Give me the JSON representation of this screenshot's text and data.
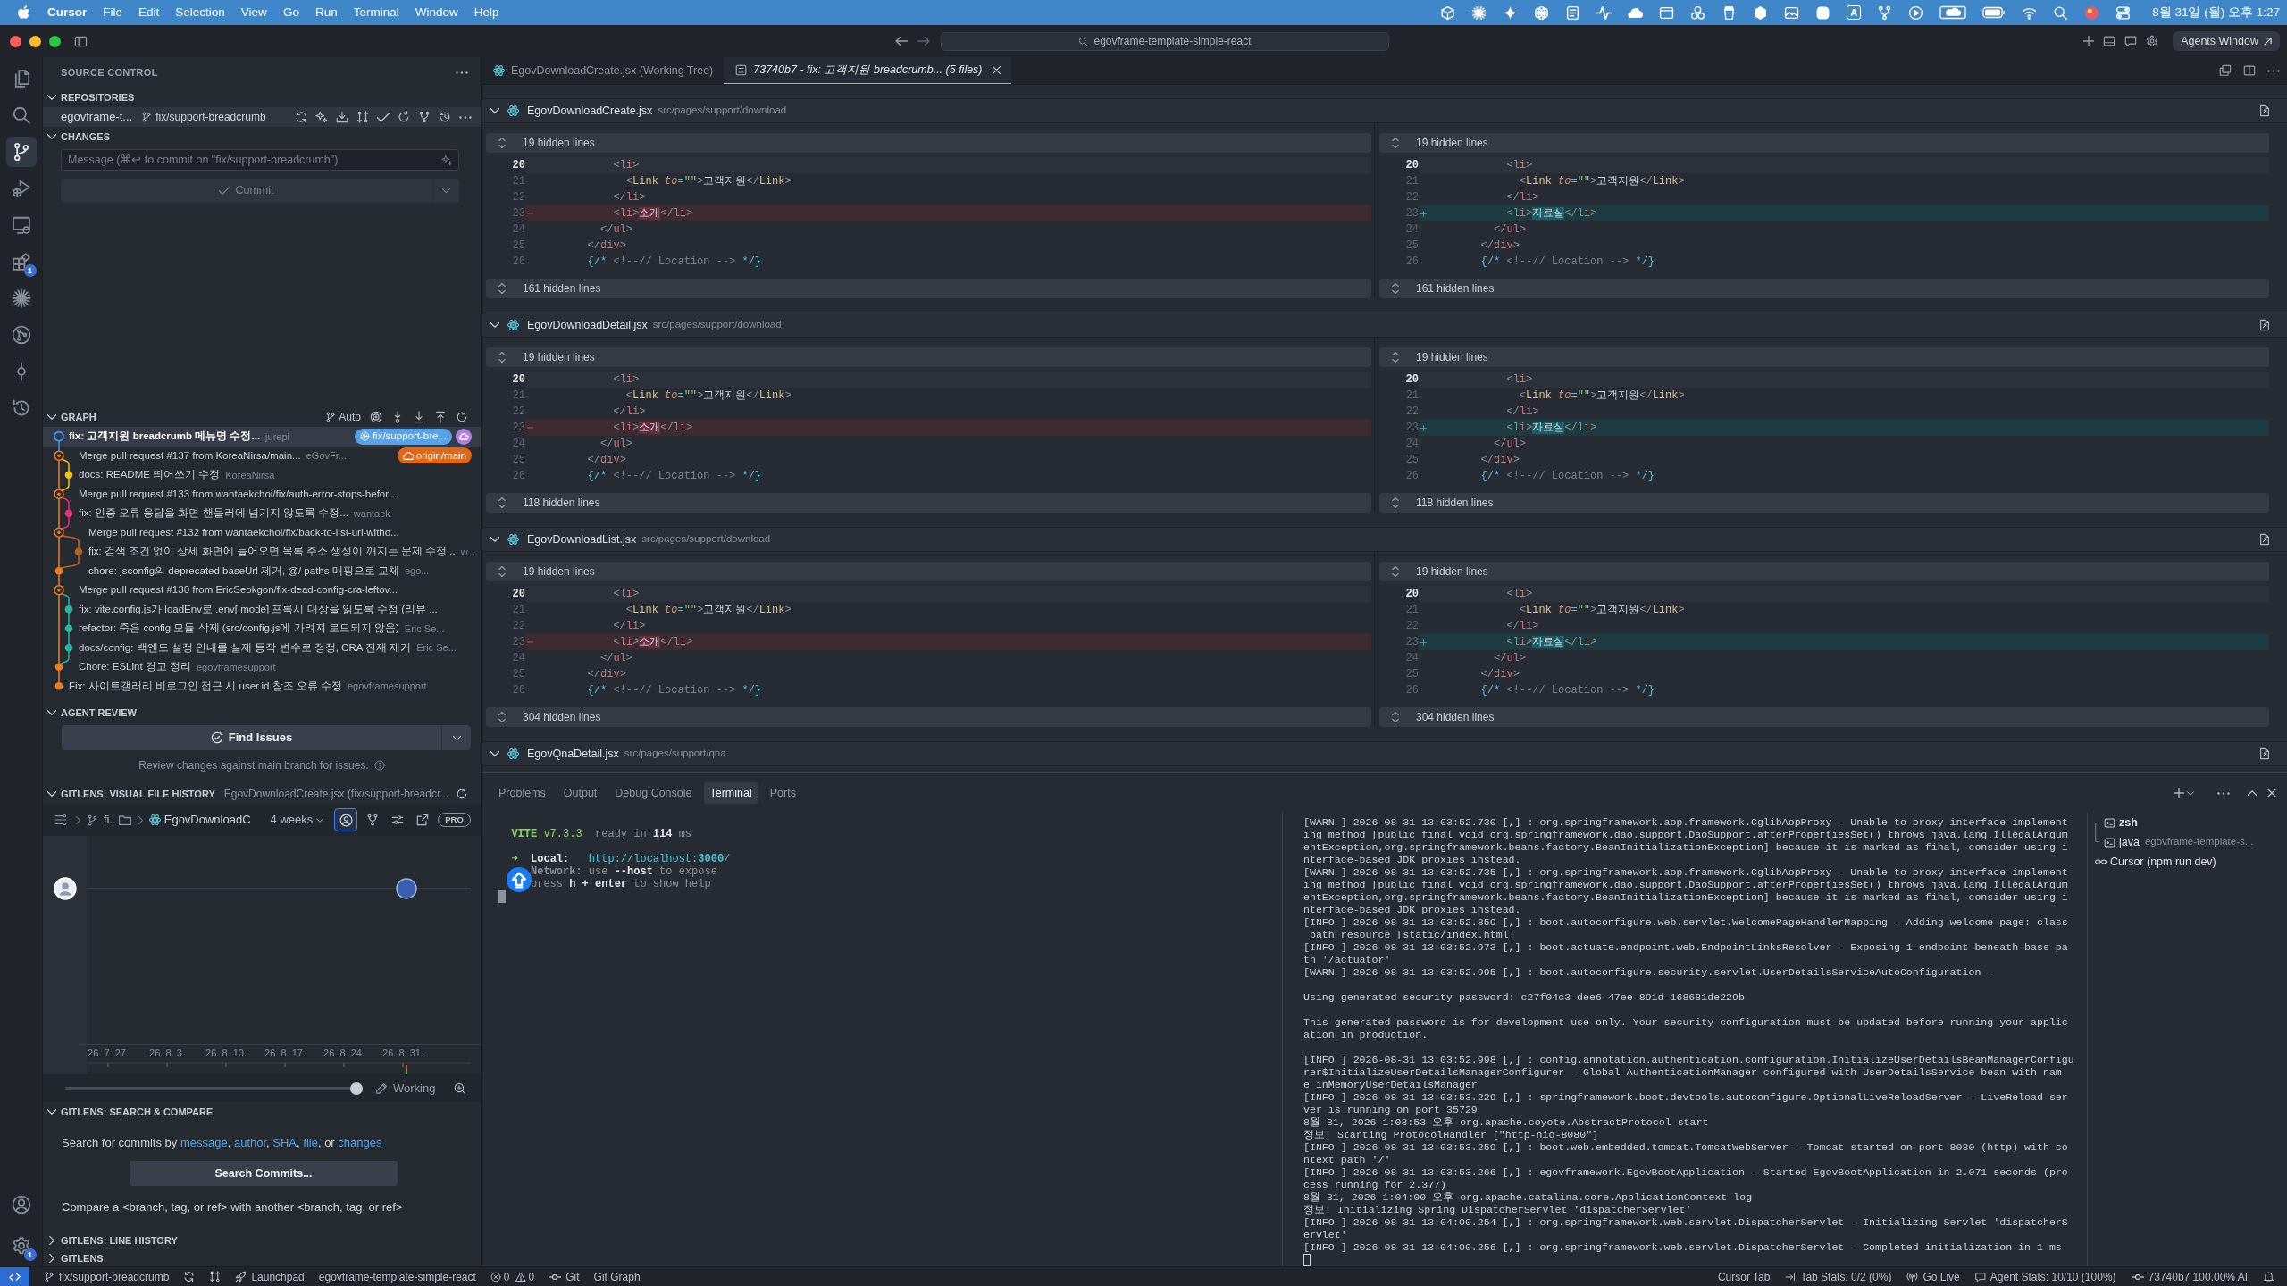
{
  "menu_bar": {
    "app": "Cursor",
    "items": [
      "File",
      "Edit",
      "Selection",
      "View",
      "Go",
      "Run",
      "Terminal",
      "Window",
      "Help"
    ],
    "input_source": "A",
    "clock": "8월 31일 (월) 오후 1:27"
  },
  "title_bar": {
    "search": "egovframe-template-simple-react",
    "agents_button": "Agents Window"
  },
  "activity_bar": {
    "items": [
      {
        "selected": false
      },
      {
        "selected": false
      },
      {
        "selected": true
      },
      {
        "selected": false
      },
      {
        "selected": false
      },
      {
        "selected": false,
        "badge": "1"
      },
      {
        "selected": false
      },
      {
        "selected": false
      },
      {
        "selected": false
      },
      {
        "selected": false
      }
    ],
    "bottom": [
      {
        "selected": false
      },
      {
        "selected": false,
        "badge": "1"
      }
    ]
  },
  "sidebar": {
    "title": "SOURCE CONTROL",
    "repositories": {
      "header": "REPOSITORIES",
      "expanded": true,
      "repo": "egovframe-t...",
      "branch": "fix/support-breadcrumb"
    },
    "changes": {
      "header": "CHANGES",
      "expanded": true,
      "message_placeholder": "Message (⌘↩ to commit on \"fix/support-breadcrumb\")",
      "commit_button": "Commit",
      "commit_disabled": true
    },
    "graph": {
      "header": "GRAPH",
      "expanded": true,
      "mode": "Auto",
      "commits": [
        {
          "message": "fix: 고객지원 breadcrumb 메뉴명 수정...",
          "author": "jurepi",
          "kind": "head",
          "color": "#3794ff",
          "selected": true,
          "tags": [
            {
              "kind": "local",
              "text": "fix/support-bre..."
            },
            {
              "kind": "cloud"
            }
          ]
        },
        {
          "message": "Merge pull request #137 from KoreaNirsa/main...",
          "author": "eGovFr...",
          "kind": "merge",
          "color": "#f07d1a",
          "selected": false,
          "tags": [
            {
              "kind": "remote",
              "text": "origin/main"
            }
          ]
        },
        {
          "message": "docs: README 띄어쓰기 수정",
          "author": "KoreaNirsa",
          "kind": "branch",
          "color": "#f5c211",
          "selected": false
        },
        {
          "message": "Merge pull request #133 from wantaekchoi/fix/auth-error-stops-befor...",
          "kind": "merge",
          "color": "#f07d1a",
          "selected": false
        },
        {
          "message": "fix: 인증 오류 응답을 화면 핸들러에 넘기지 않도록 수정...",
          "author": "wantaek",
          "kind": "branch",
          "color": "#e8317a",
          "selected": false
        },
        {
          "message": "Merge pull request #132 from wantaekchoi/fix/back-to-list-url-witho...",
          "kind": "merge",
          "color": "#f07d1a",
          "selected": false
        },
        {
          "message": "fix: 검색 조건 없이 상세 화면에 들어오면 목록 주소 생성이 깨지는 문제 수정...",
          "author": "w...",
          "kind": "nested",
          "color": "#b8651b",
          "selected": false
        },
        {
          "message": "chore: jsconfig의 deprecated baseUrl 제거, @/ paths 매핑으로 교체",
          "author": "ego...",
          "kind": "commit",
          "color": "#f07d1a",
          "selected": false
        },
        {
          "message": "Merge pull request #130 from EricSeokgon/fix-dead-config-cra-leftov...",
          "kind": "merge",
          "color": "#f07d1a",
          "selected": false
        },
        {
          "message": "fix: vite.config.js가 loadEnv로 .env[.mode] 프록시 대상을 읽도록 수정 (리뷰 ...",
          "kind": "branch",
          "color": "#2ab5a0",
          "selected": false
        },
        {
          "message": "refactor: 죽은 config 모듈 삭제 (src/config.js에 가려져 로드되지 않음)",
          "author": "Eric Se...",
          "kind": "branch",
          "color": "#2ab5a0",
          "selected": false
        },
        {
          "message": "docs/config: 백엔드 설정 안내를 실제 동작 변수로 정정, CRA 잔재 제거",
          "author": "Eric Se...",
          "kind": "branch",
          "color": "#2ab5a0",
          "selected": false
        },
        {
          "message": "Chore: ESLint 경고 정리",
          "author": "egovframesupport",
          "kind": "commit",
          "color": "#f07d1a",
          "selected": false
        },
        {
          "message": "Fix: 사이트갤러리 비로그인 접근 시 user.id 참조 오류 수정",
          "author": "egovframesupport",
          "kind": "commit",
          "color": "#f07d1a",
          "selected": false
        }
      ]
    },
    "agent_review": {
      "header": "AGENT REVIEW",
      "expanded": true,
      "button": "Find Issues",
      "hint": "Review changes against main branch for issues."
    },
    "file_history": {
      "header": "GITLENS: VISUAL FILE HISTORY",
      "expanded": true,
      "subtitle": "EgovDownloadCreate.jsx (fix/support-breadcr...",
      "folder": "fi..",
      "file": "EgovDownloadC",
      "period": "4 weeks",
      "author_view_selected": true,
      "pro": "PRO",
      "dates": [
        "26. 7. 27.",
        "26. 8. 3.",
        "26. 8. 10.",
        "26. 8. 17.",
        "26. 8. 24.",
        "26. 8. 31."
      ],
      "range": {
        "level": 0.98
      },
      "working": "Working"
    },
    "search_compare": {
      "header": "GITLENS: SEARCH & COMPARE",
      "expanded": true,
      "search_hint": [
        {
          "text": "Search for commits by ",
          "link": false
        },
        {
          "text": "message",
          "link": true
        },
        {
          "text": ", ",
          "link": false
        },
        {
          "text": "author",
          "link": true
        },
        {
          "text": ", ",
          "link": false
        },
        {
          "text": "SHA",
          "link": true
        },
        {
          "text": ", ",
          "link": false
        },
        {
          "text": "file",
          "link": true
        },
        {
          "text": ", or ",
          "link": false
        },
        {
          "text": "changes",
          "link": true
        }
      ],
      "button": "Search Commits...",
      "compare_hint": "Compare a <branch, tag, or ref> with another <branch, tag, or ref>"
    },
    "collapsed": [
      {
        "header": "GITLENS: LINE HISTORY",
        "expanded": false
      },
      {
        "header": "GITLENS",
        "expanded": false
      }
    ]
  },
  "editor": {
    "tabs": [
      {
        "label": "EgovDownloadCreate.jsx (Working Tree)",
        "kind": "file",
        "selected": false,
        "preview": false
      },
      {
        "label": "73740b7 - fix: 고객지원 breadcrumb... (5 files)",
        "kind": "diff",
        "selected": true,
        "preview": true
      }
    ],
    "files": [
      {
        "name": "EgovDownloadCreate.jsx",
        "path": "src/pages/support/download",
        "expanded": true,
        "left": {
          "hidden_above": "19 hidden lines",
          "hidden_below": "161 hidden lines",
          "lines": [
            {
              "number": "20",
              "text": "            <li>",
              "kind": "context",
              "active": true
            },
            {
              "number": "21",
              "text": "              <Link to=\"\">고객지원</Link>",
              "kind": "context",
              "active": false
            },
            {
              "number": "22",
              "text": "            </li>",
              "kind": "context",
              "active": false
            },
            {
              "number": "23",
              "parts": [
                {
                  "text": "            <li>",
                  "changed": false
                },
                {
                  "text": "소개",
                  "changed": true
                },
                {
                  "text": "</li>",
                  "changed": false
                }
              ],
              "kind": "removed",
              "active": false
            },
            {
              "number": "24",
              "text": "          </ul>",
              "kind": "context",
              "active": false
            },
            {
              "number": "25",
              "text": "        </div>",
              "kind": "context",
              "active": false
            },
            {
              "number": "26",
              "text": "        {/* <!--// Location --> */}",
              "kind": "context",
              "active": false
            }
          ]
        },
        "right": {
          "hidden_above": "19 hidden lines",
          "hidden_below": "161 hidden lines",
          "lines": [
            {
              "number": "20",
              "text": "            <li>",
              "kind": "context",
              "active": true
            },
            {
              "number": "21",
              "text": "              <Link to=\"\">고객지원</Link>",
              "kind": "context",
              "active": false
            },
            {
              "number": "22",
              "text": "            </li>",
              "kind": "context",
              "active": false
            },
            {
              "number": "23",
              "parts": [
                {
                  "text": "            <li>",
                  "changed": false
                },
                {
                  "text": "자료실",
                  "changed": true
                },
                {
                  "text": "</li>",
                  "changed": false
                }
              ],
              "kind": "added",
              "active": false
            },
            {
              "number": "24",
              "text": "          </ul>",
              "kind": "context",
              "active": false
            },
            {
              "number": "25",
              "text": "        </div>",
              "kind": "context",
              "active": false
            },
            {
              "number": "26",
              "text": "        {/* <!--// Location --> */}",
              "kind": "context",
              "active": false
            }
          ]
        }
      },
      {
        "name": "EgovDownloadDetail.jsx",
        "path": "src/pages/support/download",
        "expanded": true,
        "left": {
          "hidden_above": "19 hidden lines",
          "hidden_below": "118 hidden lines",
          "lines": [
            {
              "number": "20",
              "text": "            <li>",
              "kind": "context",
              "active": true
            },
            {
              "number": "21",
              "text": "              <Link to=\"\">고객지원</Link>",
              "kind": "context",
              "active": false
            },
            {
              "number": "22",
              "text": "            </li>",
              "kind": "context",
              "active": false
            },
            {
              "number": "23",
              "parts": [
                {
                  "text": "            <li>",
                  "changed": false
                },
                {
                  "text": "소개",
                  "changed": true
                },
                {
                  "text": "</li>",
                  "changed": false
                }
              ],
              "kind": "removed",
              "active": false
            },
            {
              "number": "24",
              "text": "          </ul>",
              "kind": "context",
              "active": false
            },
            {
              "number": "25",
              "text": "        </div>",
              "kind": "context",
              "active": false
            },
            {
              "number": "26",
              "text": "        {/* <!--// Location --> */}",
              "kind": "context",
              "active": false
            }
          ]
        },
        "right": {
          "hidden_above": "19 hidden lines",
          "hidden_below": "118 hidden lines",
          "lines": [
            {
              "number": "20",
              "text": "            <li>",
              "kind": "context",
              "active": true
            },
            {
              "number": "21",
              "text": "              <Link to=\"\">고객지원</Link>",
              "kind": "context",
              "active": false
            },
            {
              "number": "22",
              "text": "            </li>",
              "kind": "context",
              "active": false
            },
            {
              "number": "23",
              "parts": [
                {
                  "text": "            <li>",
                  "changed": false
                },
                {
                  "text": "자료실",
                  "changed": true
                },
                {
                  "text": "</li>",
                  "changed": false
                }
              ],
              "kind": "added",
              "active": false
            },
            {
              "number": "24",
              "text": "          </ul>",
              "kind": "context",
              "active": false
            },
            {
              "number": "25",
              "text": "        </div>",
              "kind": "context",
              "active": false
            },
            {
              "number": "26",
              "text": "        {/* <!--// Location --> */}",
              "kind": "context",
              "active": false
            }
          ]
        }
      },
      {
        "name": "EgovDownloadList.jsx",
        "path": "src/pages/support/download",
        "expanded": true,
        "left": {
          "hidden_above": "19 hidden lines",
          "hidden_below": "304 hidden lines",
          "lines": [
            {
              "number": "20",
              "text": "            <li>",
              "kind": "context",
              "active": true
            },
            {
              "number": "21",
              "text": "              <Link to=\"\">고객지원</Link>",
              "kind": "context",
              "active": false
            },
            {
              "number": "22",
              "text": "            </li>",
              "kind": "context",
              "active": false
            },
            {
              "number": "23",
              "parts": [
                {
                  "text": "            <li>",
                  "changed": false
                },
                {
                  "text": "소개",
                  "changed": true
                },
                {
                  "text": "</li>",
                  "changed": false
                }
              ],
              "kind": "removed",
              "active": false
            },
            {
              "number": "24",
              "text": "          </ul>",
              "kind": "context",
              "active": false
            },
            {
              "number": "25",
              "text": "        </div>",
              "kind": "context",
              "active": false
            },
            {
              "number": "26",
              "text": "        {/* <!--// Location --> */}",
              "kind": "context",
              "active": false
            }
          ]
        },
        "right": {
          "hidden_above": "19 hidden lines",
          "hidden_below": "304 hidden lines",
          "lines": [
            {
              "number": "20",
              "text": "            <li>",
              "kind": "context",
              "active": true
            },
            {
              "number": "21",
              "text": "              <Link to=\"\">고객지원</Link>",
              "kind": "context",
              "active": false
            },
            {
              "number": "22",
              "text": "            </li>",
              "kind": "context",
              "active": false
            },
            {
              "number": "23",
              "parts": [
                {
                  "text": "            <li>",
                  "changed": false
                },
                {
                  "text": "자료실",
                  "changed": true
                },
                {
                  "text": "</li>",
                  "changed": false
                }
              ],
              "kind": "added",
              "active": false
            },
            {
              "number": "24",
              "text": "          </ul>",
              "kind": "context",
              "active": false
            },
            {
              "number": "25",
              "text": "        </div>",
              "kind": "context",
              "active": false
            },
            {
              "number": "26",
              "text": "        {/* <!--// Location --> */}",
              "kind": "context",
              "active": false
            }
          ]
        }
      },
      {
        "name": "EgovQnaDetail.jsx",
        "path": "src/pages/support/qna",
        "expanded": true
      }
    ]
  },
  "panel": {
    "tabs": [
      {
        "label": "Problems",
        "selected": false
      },
      {
        "label": "Output",
        "selected": false
      },
      {
        "label": "Debug Console",
        "selected": false
      },
      {
        "label": "Terminal",
        "selected": true
      },
      {
        "label": "Ports",
        "selected": false
      }
    ],
    "vite": [
      {
        "lines": [
          {
            "parts": [
              {
                "text": "  VITE",
                "kind": "brand-bold"
              },
              {
                "text": " v7.3.3",
                "kind": "brand"
              },
              {
                "text": "  ready in ",
                "kind": "dim"
              },
              {
                "text": "114",
                "kind": "strong"
              },
              {
                "text": " ms",
                "kind": "dim"
              }
            ]
          }
        ]
      },
      {
        "lines": [
          {
            "parts": [
              {
                "text": "  ➜  ",
                "kind": "arrow"
              },
              {
                "text": "Local:",
                "kind": "strong"
              },
              {
                "text": "   http://localhost:",
                "kind": "url"
              },
              {
                "text": "3000",
                "kind": "url-bold"
              },
              {
                "text": "/",
                "kind": "url"
              }
            ]
          },
          {
            "parts": [
              {
                "text": "     Network:",
                "kind": "dim-bold"
              },
              {
                "text": " use ",
                "kind": "dim"
              },
              {
                "text": "--host",
                "kind": "strong"
              },
              {
                "text": " to expose",
                "kind": "dim"
              }
            ]
          },
          {
            "parts": [
              {
                "text": "     press ",
                "kind": "dim"
              },
              {
                "text": "h + enter",
                "kind": "strong"
              },
              {
                "text": " to show help",
                "kind": "dim"
              }
            ]
          }
        ]
      }
    ],
    "server_log": [
      [
        "[WARN ] 2026-08-31 13:03:52.730 [,] : org.springframework.aop.framework.CglibAopProxy - Unable to proxy interface-implement",
        "ing method [public final void org.springframework.dao.support.DaoSupport.afterPropertiesSet() throws java.lang.IllegalArgum",
        "entException,org.springframework.beans.factory.BeanInitializationException] because it is marked as final, consider using i",
        "nterface-based JDK proxies instead.",
        "[WARN ] 2026-08-31 13:03:52.735 [,] : org.springframework.aop.framework.CglibAopProxy - Unable to proxy interface-implement",
        "ing method [public final void org.springframework.dao.support.DaoSupport.afterPropertiesSet() throws java.lang.IllegalArgum",
        "entException,org.springframework.beans.factory.BeanInitializationException] because it is marked as final, consider using i",
        "nterface-based JDK proxies instead.",
        "[INFO ] 2026-08-31 13:03:52.859 [,] : boot.autoconfigure.web.servlet.WelcomePageHandlerMapping - Adding welcome page: class",
        " path resource [static/index.html]",
        "[INFO ] 2026-08-31 13:03:52.973 [,] : boot.actuate.endpoint.web.EndpointLinksResolver - Exposing 1 endpoint beneath base pa",
        "th '/actuator'",
        "[WARN ] 2026-08-31 13:03:52.995 [,] : boot.autoconfigure.security.servlet.UserDetailsServiceAutoConfiguration -"
      ],
      [
        "Using generated security password: c27f04c3-dee6-47ee-891d-168681de229b"
      ],
      [
        "This generated password is for development use only. Your security configuration must be updated before running your applic",
        "ation in production."
      ],
      [
        "[INFO ] 2026-08-31 13:03:52.998 [,] : config.annotation.authentication.configuration.InitializeUserDetailsBeanManagerConfigu",
        "rer$InitializeUserDetailsManagerConfigurer - Global AuthenticationManager configured with UserDetailsService bean with nam",
        "e inMemoryUserDetailsManager",
        "[INFO ] 2026-08-31 13:03:53.229 [,] : springframework.boot.devtools.autoconfigure.OptionalLiveReloadServer - LiveReload ser",
        "ver is running on port 35729",
        "8월 31, 2026 1:03:53 오후 org.apache.coyote.AbstractProtocol start",
        "정보: Starting ProtocolHandler [\"http-nio-8080\"]",
        "[INFO ] 2026-08-31 13:03:53.259 [,] : boot.web.embedded.tomcat.TomcatWebServer - Tomcat started on port 8080 (http) with co",
        "ntext path '/'",
        "[INFO ] 2026-08-31 13:03:53.266 [,] : egovframework.EgovBootApplication - Started EgovBootApplication in 2.071 seconds (pro",
        "cess running for 2.377)",
        "8월 31, 2026 1:04:00 오후 org.apache.catalina.core.ApplicationContext log",
        "정보: Initializing Spring DispatcherServlet 'dispatcherServlet'",
        "[INFO ] 2026-08-31 13:04:00.254 [,] : org.springframework.web.servlet.DispatcherServlet - Initializing Servlet 'dispatcherS",
        "ervlet'",
        "[INFO ] 2026-08-31 13:04:00.256 [,] : org.springframework.web.servlet.DispatcherServlet - Completed initialization in 1 ms"
      ]
    ],
    "terminals": [
      {
        "name": "zsh",
        "kind": "split-first"
      },
      {
        "name": "java",
        "detail": "egovframe-template-s...",
        "kind": "split-last"
      },
      {
        "name": "Cursor (npm run dev)",
        "kind": "task"
      }
    ]
  },
  "status_bar": {
    "left": [
      {
        "kind": "remote"
      },
      {
        "kind": "branch",
        "text": "fix/support-breadcrumb"
      },
      {
        "kind": "sync"
      },
      {
        "kind": "compare"
      },
      {
        "kind": "launchpad",
        "text": "Launchpad"
      },
      {
        "kind": "text",
        "text": "egovframe-template-simple-react"
      },
      {
        "kind": "problems",
        "errors": "0",
        "warnings": "0"
      },
      {
        "kind": "git",
        "text": "Git"
      },
      {
        "kind": "text",
        "text": "Git Graph"
      }
    ],
    "right": [
      {
        "kind": "text",
        "text": "Cursor Tab"
      },
      {
        "kind": "tab_stats",
        "text": "Tab Stats: 0/2 (0%)"
      },
      {
        "kind": "go_live",
        "text": "Go Live"
      },
      {
        "kind": "agent_stats",
        "text": "Agent Stats: 10/10 (100%)"
      },
      {
        "kind": "commit",
        "text": "73740b7 100.00% AI"
      },
      {
        "kind": "bell"
      }
    ]
  }
}
